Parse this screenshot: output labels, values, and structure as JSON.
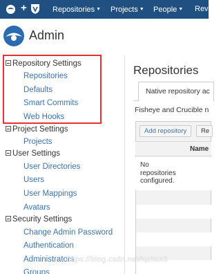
{
  "topbar": {
    "nav": [
      {
        "label": "Repositories"
      },
      {
        "label": "Projects"
      },
      {
        "label": "People"
      },
      {
        "label": "Revi"
      }
    ],
    "plus_label": "+"
  },
  "header": {
    "title": "Admin"
  },
  "sidebar": {
    "sections": [
      {
        "title": "Repository Settings",
        "items": [
          "Repositories",
          "Defaults",
          "Smart Commits",
          "Web Hooks"
        ]
      },
      {
        "title": "Project Settings",
        "items": [
          "Projects"
        ]
      },
      {
        "title": "User Settings",
        "items": [
          "User Directories",
          "Users",
          "User Mappings",
          "Avatars"
        ]
      },
      {
        "title": "Security Settings",
        "items": [
          "Change Admin Password",
          "Authentication",
          "Administrators",
          "Groups"
        ]
      }
    ]
  },
  "main": {
    "title": "Repositories",
    "tab_label": "Native repository ac",
    "description": "Fisheye and Crucible n",
    "add_button": "Add repository",
    "other_button": "Re",
    "column_header": "Name",
    "empty_message": "No repositories configured."
  },
  "watermark": "https://blog.csdn.net/lqzkcx3",
  "colors": {
    "topbar": "#205081",
    "link": "#3b73af",
    "highlight": "#e8312f"
  }
}
